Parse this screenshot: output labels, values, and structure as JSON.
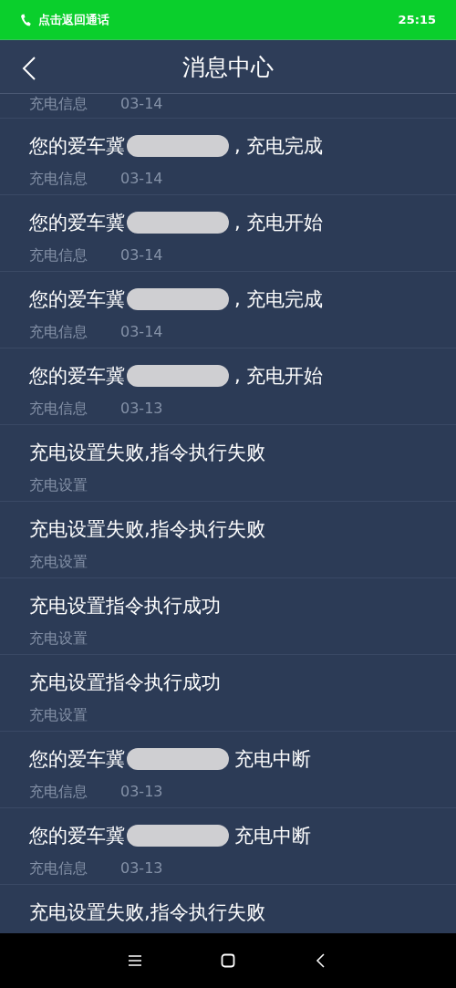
{
  "status_bar": {
    "call_text": "点击返回通话",
    "time": "25:15"
  },
  "header": {
    "title": "消息中心"
  },
  "messages": [
    {
      "kind": "meta_only",
      "category": "充电信息",
      "date": "03-14"
    },
    {
      "kind": "plate",
      "prefix": "您的爱车冀",
      "suffix": ", 充电完成",
      "category": "充电信息",
      "date": "03-14"
    },
    {
      "kind": "plate",
      "prefix": "您的爱车冀",
      "suffix": ", 充电开始",
      "category": "充电信息",
      "date": "03-14"
    },
    {
      "kind": "plate",
      "prefix": "您的爱车冀",
      "suffix": ", 充电完成",
      "category": "充电信息",
      "date": "03-14"
    },
    {
      "kind": "plate",
      "prefix": "您的爱车冀",
      "suffix": ", 充电开始",
      "category": "充电信息",
      "date": "03-13"
    },
    {
      "kind": "plain",
      "title": "充电设置失败,指令执行失败",
      "category": "充电设置"
    },
    {
      "kind": "plain",
      "title": "充电设置失败,指令执行失败",
      "category": "充电设置"
    },
    {
      "kind": "plain",
      "title": "充电设置指令执行成功",
      "category": "充电设置"
    },
    {
      "kind": "plain",
      "title": "充电设置指令执行成功",
      "category": "充电设置"
    },
    {
      "kind": "plate",
      "prefix": "您的爱车冀",
      "suffix": "充电中断",
      "category": "充电信息",
      "date": "03-13"
    },
    {
      "kind": "plate",
      "prefix": "您的爱车冀",
      "suffix": "充电中断",
      "category": "充电信息",
      "date": "03-13"
    },
    {
      "kind": "title_only",
      "title": "充电设置失败,指令执行失败"
    }
  ]
}
